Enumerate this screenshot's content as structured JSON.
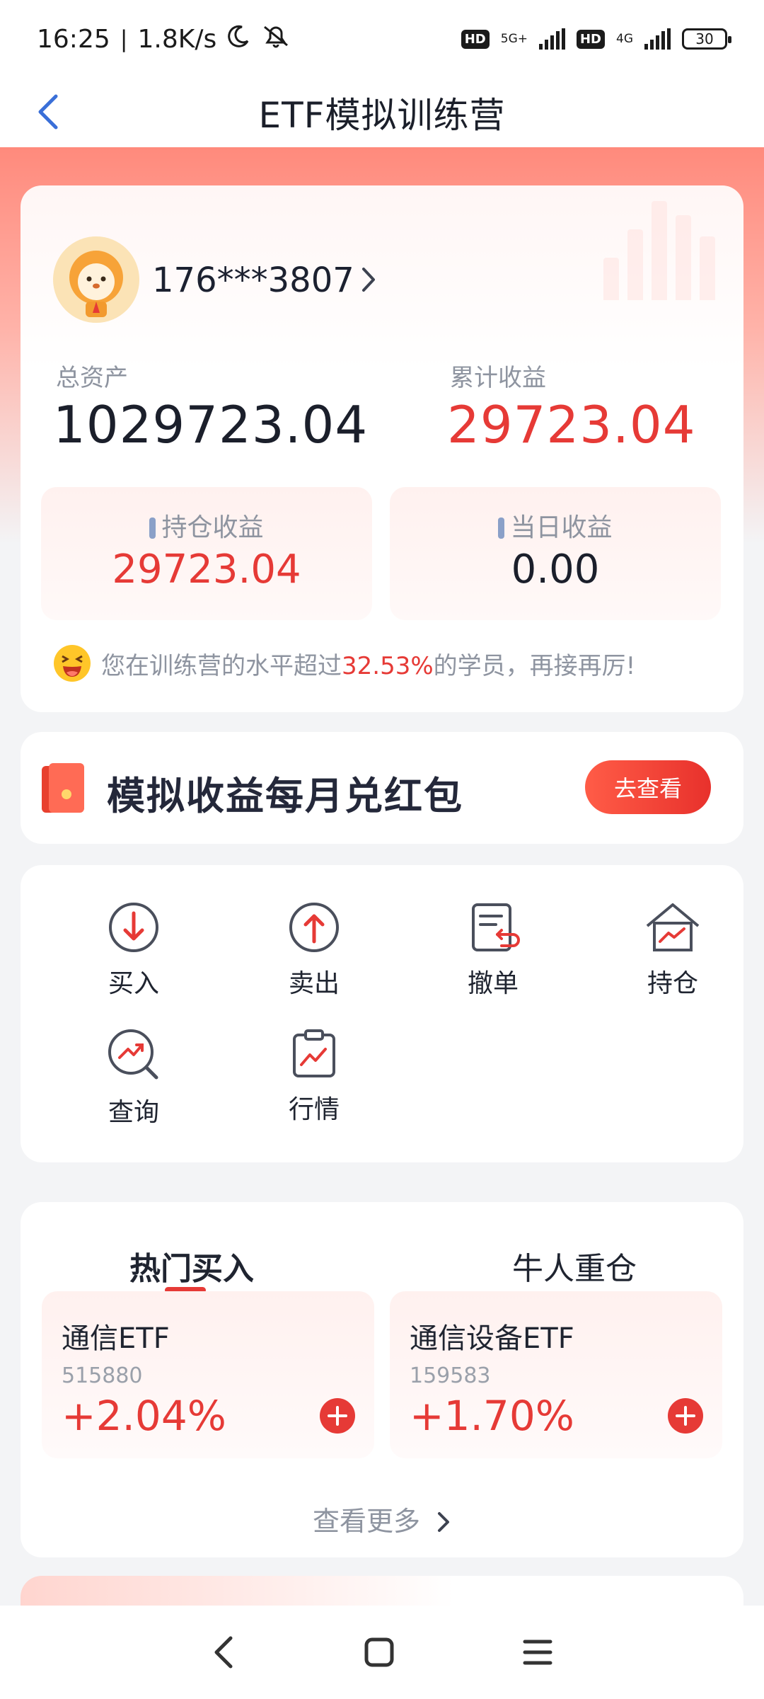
{
  "status_bar": {
    "time": "16:25",
    "speed": "1.8K/s",
    "net1": "5G+",
    "net2": "4G",
    "hd": "HD",
    "battery": "30"
  },
  "header": {
    "title": "ETF模拟训练营"
  },
  "account": {
    "user_id": "176***3807",
    "total_assets_label": "总资产",
    "total_assets": "1029723.04",
    "cum_profit_label": "累计收益",
    "cum_profit": "29723.04",
    "holding_profit_label": "持仓收益",
    "holding_profit": "29723.04",
    "daily_profit_label": "当日收益",
    "daily_profit": "0.00",
    "rank_prefix": "您在训练营的水平超过",
    "rank_percent": "32.53%",
    "rank_suffix": "的学员，再接再厉!"
  },
  "promo": {
    "title": "模拟收益每月兑红包",
    "button": "去查看"
  },
  "actions": [
    {
      "label": "买入",
      "icon": "buy-icon"
    },
    {
      "label": "卖出",
      "icon": "sell-icon"
    },
    {
      "label": "撤单",
      "icon": "cancel-order-icon"
    },
    {
      "label": "持仓",
      "icon": "holdings-icon"
    },
    {
      "label": "查询",
      "icon": "query-icon"
    },
    {
      "label": "行情",
      "icon": "market-icon"
    }
  ],
  "hot": {
    "tabs": [
      "热门买入",
      "牛人重仓"
    ],
    "funds": [
      {
        "name": "通信ETF",
        "code": "515880",
        "change": "+2.04%"
      },
      {
        "name": "通信设备ETF",
        "code": "159583",
        "change": "+1.70%"
      }
    ],
    "more": "查看更多"
  },
  "colors": {
    "accent_red": "#e63a36",
    "text_gray": "#8e94a0"
  }
}
